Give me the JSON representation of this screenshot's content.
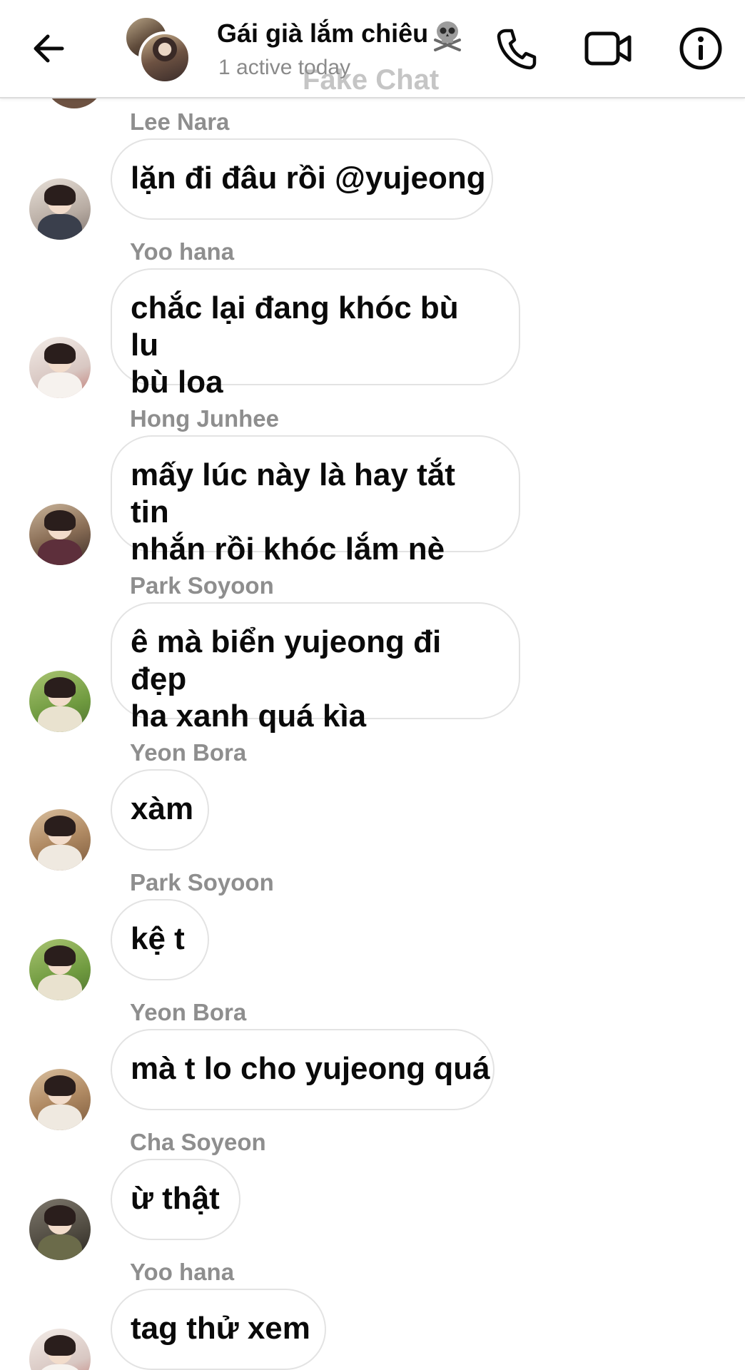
{
  "header": {
    "title": "Gái già lắm chiêu",
    "title_emoji": "skull-and-crossbones-icon",
    "status": "1 active today",
    "watermark": "Fake Chat",
    "icons": {
      "back": "arrow-left-icon",
      "call": "phone-icon",
      "video": "video-camera-icon",
      "info": "info-icon"
    }
  },
  "colors": {
    "sender_name": "#8e8e8e",
    "bubble_border": "#e3e3e3",
    "text": "#0a0a0a",
    "status": "#8a8a8a"
  },
  "messages": [
    {
      "sender": "Lee Nara",
      "text": "lặn đi đâu rồi @yujeong"
    },
    {
      "sender": "Yoo hana",
      "text": "chắc lại đang khóc bù lu\nbù loa"
    },
    {
      "sender": "Hong Junhee",
      "text": "mấy lúc này là hay tắt tin\nnhắn rồi khóc lắm nè"
    },
    {
      "sender": "Park Soyoon",
      "text": "ê mà biển yujeong đi đẹp\nha xanh quá kìa"
    },
    {
      "sender": "Yeon Bora",
      "text": "xàm"
    },
    {
      "sender": "Park Soyoon",
      "text": "kệ t"
    },
    {
      "sender": "Yeon Bora",
      "text": "mà t lo cho yujeong quá"
    },
    {
      "sender": "Cha Soyeon",
      "text": "ừ thật"
    },
    {
      "sender": "Yoo hana",
      "text": "tag thử xem"
    }
  ]
}
